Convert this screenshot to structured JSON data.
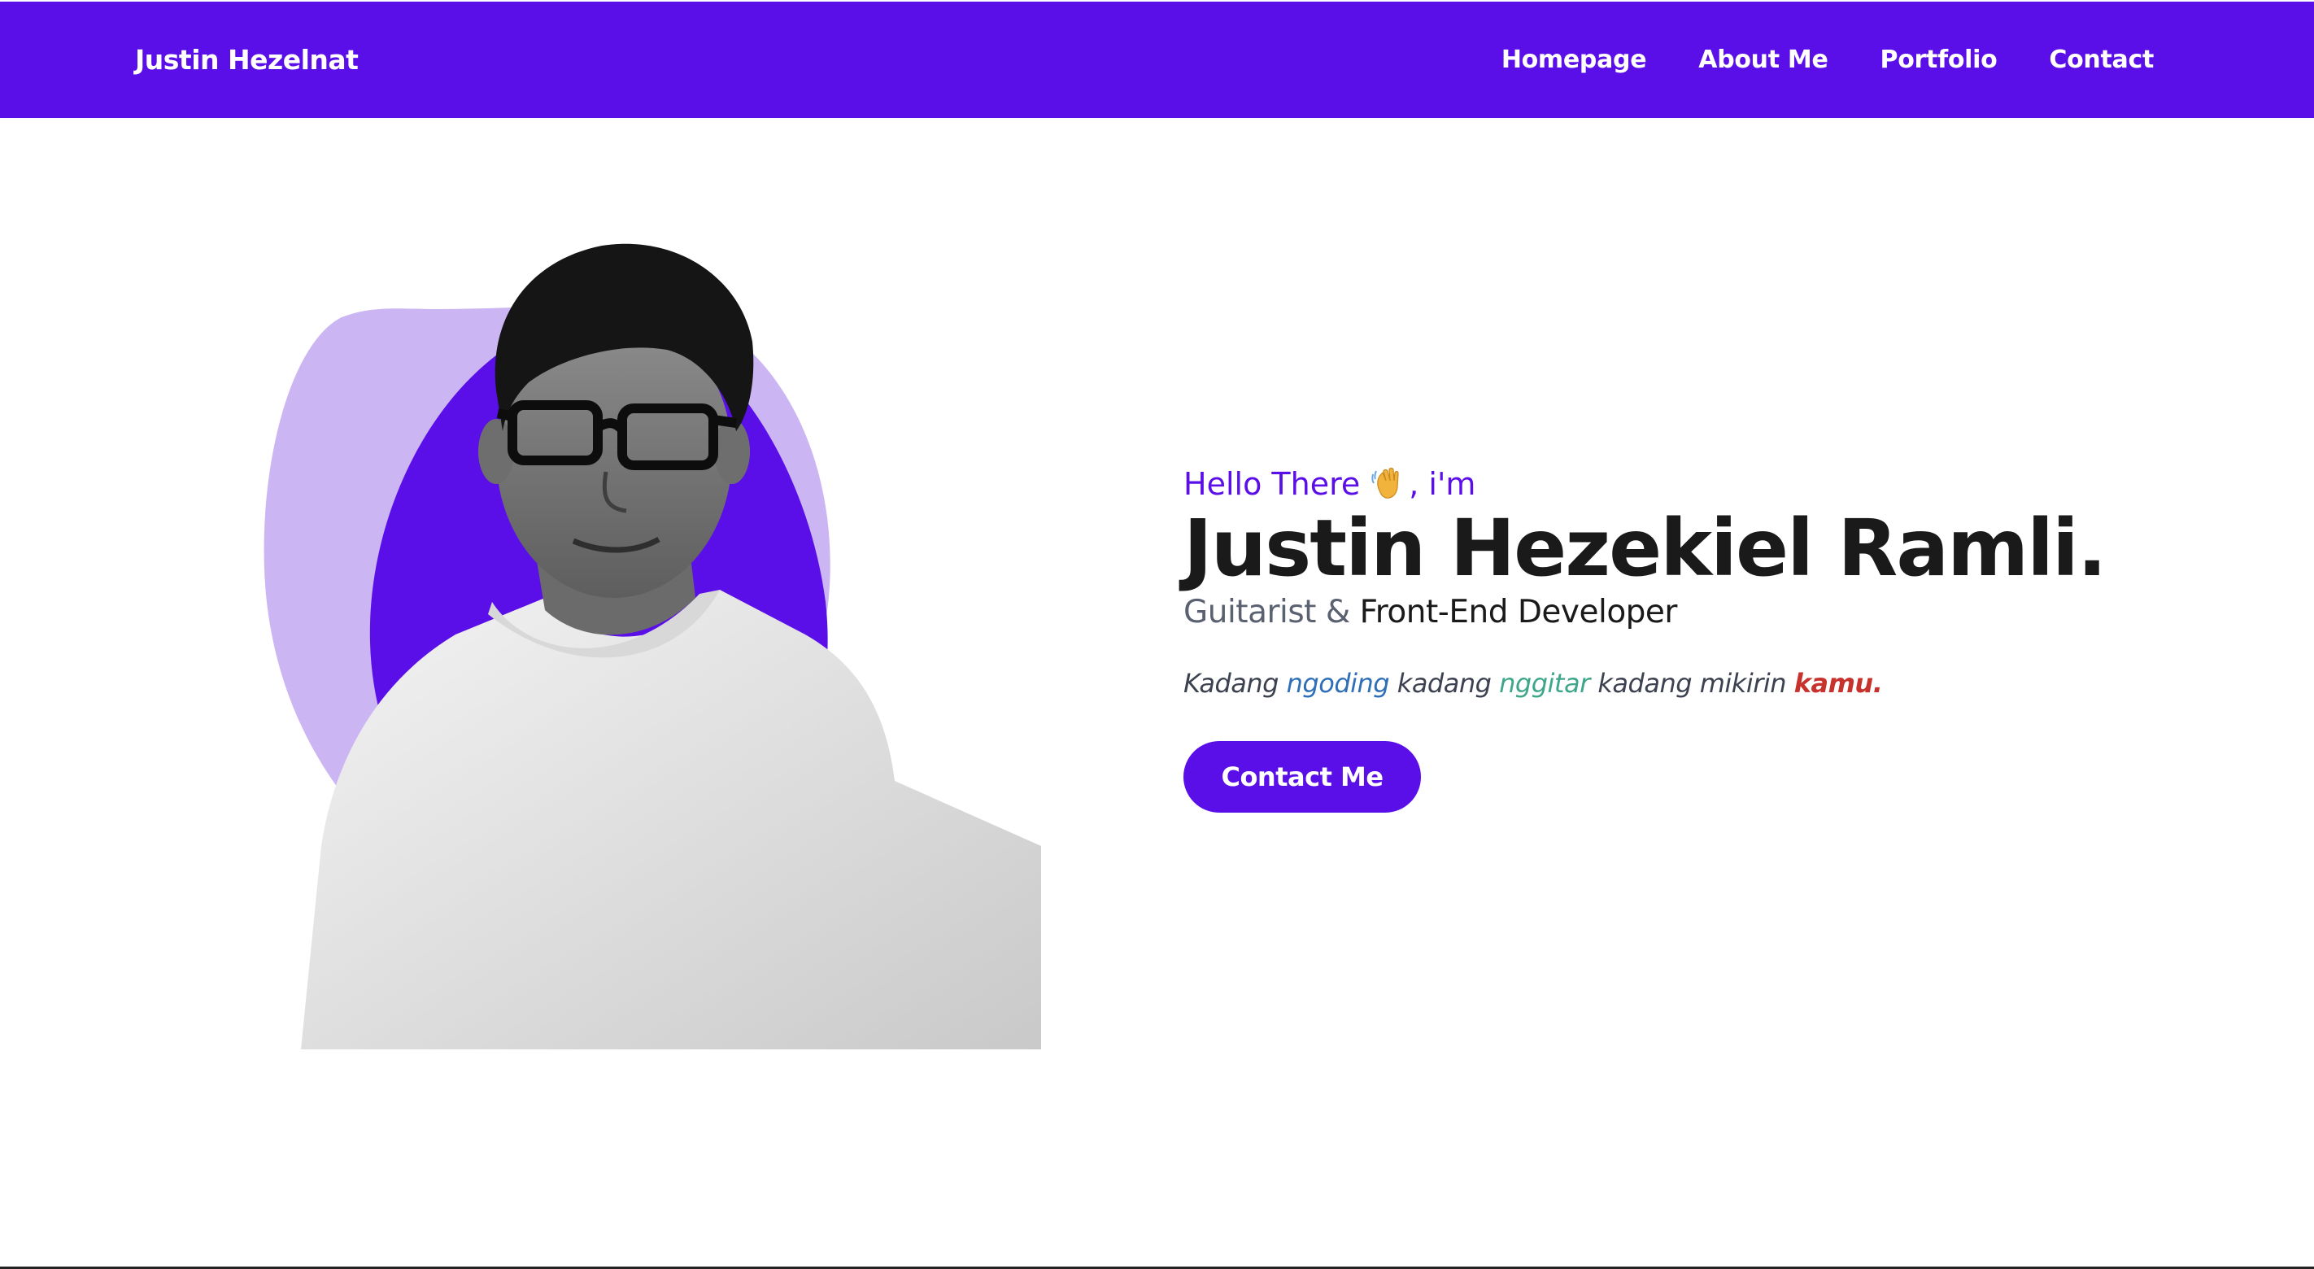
{
  "navbar": {
    "brand": "Justin Hezelnat",
    "links": [
      "Homepage",
      "About Me",
      "Portfolio",
      "Contact"
    ]
  },
  "hero": {
    "greeting_prefix": "Hello There",
    "greeting_icon": "waving-hand-icon",
    "greeting_suffix": ", i'm",
    "name": "Justin Hezekiel Ramli.",
    "role_a": "Guitarist & ",
    "role_b": "Front-End Developer",
    "tagline": {
      "p1": "Kadang ",
      "w1": "ngoding",
      "p2": " kadang ",
      "w2": "nggitar",
      "p3": " kadang mikirin ",
      "w3": "kamu."
    },
    "cta_label": "Contact Me"
  },
  "colors": {
    "primary": "#5b0fe8",
    "blob_light": "#cbb6f3",
    "text_dark": "#1a1a1a",
    "accent_blue": "#2f6fb8",
    "accent_green": "#3ea68a",
    "accent_red": "#c8322c"
  }
}
